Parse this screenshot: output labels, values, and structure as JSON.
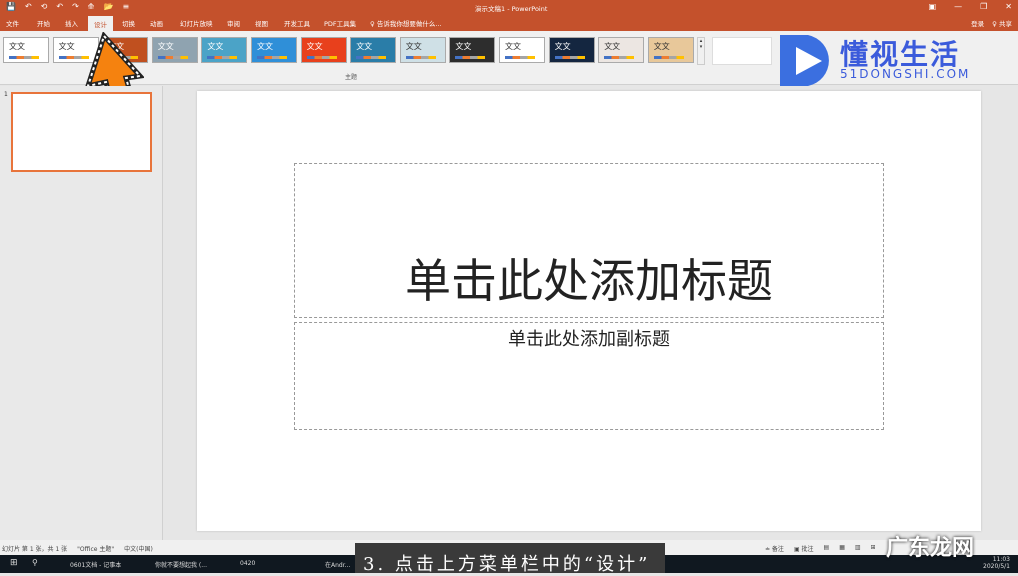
{
  "window": {
    "title": "演示文稿1 - PowerPoint",
    "controls": [
      "▣",
      "—",
      "❐",
      "✕"
    ]
  },
  "qat": [
    "💾",
    "↶",
    "⟲",
    "↶",
    "↷",
    "⟰",
    "📂",
    "≡"
  ],
  "tabs": [
    "文件",
    "开始",
    "插入",
    "设计",
    "切换",
    "动画",
    "幻灯片放映",
    "审阅",
    "视图",
    "开发工具",
    "PDF工具集",
    "♀ 告诉我你想要做什么..."
  ],
  "active_tab": "设计",
  "account": {
    "login": "登录",
    "share": "♀ 共享"
  },
  "ribbon": {
    "group_label": "主题",
    "themes": [
      {
        "label": "文文",
        "bg": "#ffffff",
        "fg": "#333"
      },
      {
        "label": "文文",
        "bg": "#ffffff",
        "fg": "#333"
      },
      {
        "label": "文文",
        "bg": "#c0501f",
        "fg": "#fff"
      },
      {
        "label": "文文",
        "bg": "#8fa3b0",
        "fg": "#fff"
      },
      {
        "label": "文文",
        "bg": "#4ba3c7",
        "fg": "#fff"
      },
      {
        "label": "文文",
        "bg": "#2f8fd8",
        "fg": "#fff"
      },
      {
        "label": "文文",
        "bg": "#e8401c",
        "fg": "#fff"
      },
      {
        "label": "文文",
        "bg": "#2a7da8",
        "fg": "#fff"
      },
      {
        "label": "文文",
        "bg": "#cfe0e6",
        "fg": "#333"
      },
      {
        "label": "文文",
        "bg": "#2d2d2d",
        "fg": "#fff"
      },
      {
        "label": "文文",
        "bg": "#ffffff",
        "fg": "#333"
      },
      {
        "label": "文文",
        "bg": "#142640",
        "fg": "#fff"
      },
      {
        "label": "文文",
        "bg": "#ece6e2",
        "fg": "#333"
      },
      {
        "label": "文文",
        "bg": "#e8c89a",
        "fg": "#333"
      }
    ]
  },
  "slide_panel": {
    "number": "1"
  },
  "slide": {
    "title_placeholder": "单击此处添加标题",
    "subtitle_placeholder": "单击此处添加副标题"
  },
  "statusbar": {
    "left": [
      "幻灯片 第 1 张，共 1 张",
      "\"Office 主题\"",
      "中文(中国)"
    ],
    "right": [
      "≐ 备注",
      "▣ 批注",
      "▤",
      "▦",
      "▥",
      "⊞"
    ]
  },
  "taskbar": {
    "items": [
      "⊞",
      "⚲",
      "0601文档 - 记事本",
      "你就不要想起我 (...",
      "0420",
      "在Andr..."
    ],
    "time": "11:03",
    "date": "2020/5/1"
  },
  "caption": "3. 点击上方菜单栏中的“设计”",
  "watermarks": {
    "logo": "懂视生活",
    "logo_sub": "51DONGSHI.COM",
    "corner": "广东龙网"
  }
}
